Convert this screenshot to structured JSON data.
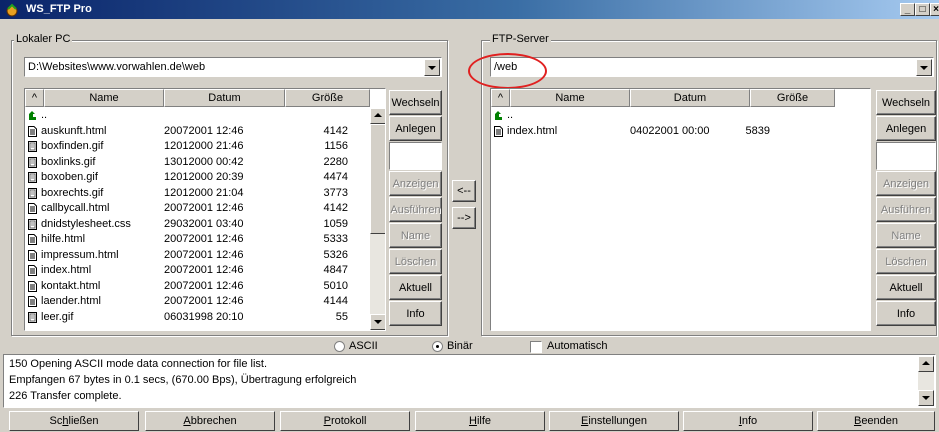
{
  "window": {
    "title": "WS_FTP Pro"
  },
  "local": {
    "legend": "Lokaler PC",
    "path": "D:\\Websites\\www.vorwahlen.de\\web",
    "columns": {
      "sort": "^",
      "name": "Name",
      "date": "Datum",
      "size": "Größe"
    },
    "files": [
      {
        "name": "..",
        "date": "",
        "size": "",
        "icon": "folder-up-icon"
      },
      {
        "name": "auskunft.html",
        "date": "20072001 12:46",
        "size": "4142",
        "icon": "document-icon"
      },
      {
        "name": "boxfinden.gif",
        "date": "12012000 21:46",
        "size": "1156",
        "icon": "image-file-icon"
      },
      {
        "name": "boxlinks.gif",
        "date": "13012000 00:42",
        "size": "2280",
        "icon": "image-file-icon"
      },
      {
        "name": "boxoben.gif",
        "date": "12012000 20:39",
        "size": "4474",
        "icon": "image-file-icon"
      },
      {
        "name": "boxrechts.gif",
        "date": "12012000 21:04",
        "size": "3773",
        "icon": "image-file-icon"
      },
      {
        "name": "callbycall.html",
        "date": "20072001 12:46",
        "size": "4142",
        "icon": "document-icon"
      },
      {
        "name": "dnidstylesheet.css",
        "date": "29032001 03:40",
        "size": "1059",
        "icon": "image-file-icon"
      },
      {
        "name": "hilfe.html",
        "date": "20072001 12:46",
        "size": "5333",
        "icon": "document-icon"
      },
      {
        "name": "impressum.html",
        "date": "20072001 12:46",
        "size": "5326",
        "icon": "document-icon"
      },
      {
        "name": "index.html",
        "date": "20072001 12:46",
        "size": "4847",
        "icon": "document-icon"
      },
      {
        "name": "kontakt.html",
        "date": "20072001 12:46",
        "size": "5010",
        "icon": "document-icon"
      },
      {
        "name": "laender.html",
        "date": "20072001 12:46",
        "size": "4144",
        "icon": "document-icon"
      },
      {
        "name": "leer.gif",
        "date": "06031998 20:10",
        "size": "55",
        "icon": "image-file-icon"
      }
    ],
    "buttons": {
      "change": "Wechseln",
      "mkdir": "Anlegen",
      "view": "Anzeigen",
      "exec": "Ausführen",
      "rename": "Name",
      "delete": "Löschen",
      "refresh": "Aktuell",
      "info": "Info"
    }
  },
  "transfer": {
    "left": "<--",
    "right": "-->"
  },
  "remote": {
    "legend": "FTP-Server",
    "path": "/web",
    "columns": {
      "sort": "^",
      "name": "Name",
      "date": "Datum",
      "size": "Größe"
    },
    "files": [
      {
        "name": "..",
        "date": "",
        "size": "",
        "icon": "folder-up-icon"
      },
      {
        "name": "index.html",
        "date": "04022001 00:00",
        "size": "5839",
        "icon": "document-icon"
      }
    ],
    "buttons": {
      "change": "Wechseln",
      "mkdir": "Anlegen",
      "view": "Anzeigen",
      "exec": "Ausführen",
      "rename": "Name",
      "delete": "Löschen",
      "refresh": "Aktuell",
      "info": "Info"
    }
  },
  "mode": {
    "ascii": "ASCII",
    "binary": "Binär",
    "auto": "Automatisch",
    "selected": "binary",
    "auto_checked": false
  },
  "log": [
    "150 Opening ASCII mode data connection for file list.",
    "Empfangen 67 bytes in 0.1 secs, (670.00 Bps), Übertragung erfolgreich",
    "226 Transfer complete."
  ],
  "bottom_buttons": {
    "close": {
      "pre": "Sc",
      "u": "h",
      "post": "ließen"
    },
    "cancel": {
      "pre": "",
      "u": "A",
      "post": "bbrechen"
    },
    "protocol": {
      "pre": "",
      "u": "P",
      "post": "rotokoll"
    },
    "help": {
      "pre": "",
      "u": "H",
      "post": "ilfe"
    },
    "settings": {
      "pre": "",
      "u": "E",
      "post": "instellungen"
    },
    "info": {
      "pre": "",
      "u": "I",
      "post": "nfo"
    },
    "quit": {
      "pre": "",
      "u": "B",
      "post": "eenden"
    }
  }
}
